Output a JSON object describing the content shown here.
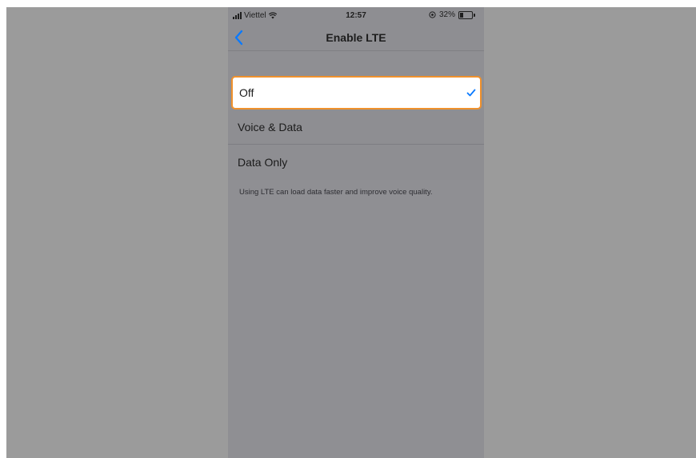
{
  "status_bar": {
    "carrier": "Viettel",
    "time": "12:57",
    "battery_percent": "32%",
    "battery_level": 0.32
  },
  "nav": {
    "title": "Enable LTE"
  },
  "options": [
    {
      "label": "Off",
      "selected": true
    },
    {
      "label": "Voice & Data",
      "selected": false
    },
    {
      "label": "Data Only",
      "selected": false
    }
  ],
  "footer_note": "Using LTE can load data faster and improve voice quality.",
  "colors": {
    "accent": "#0a7aff",
    "highlight_border": "#f0912c",
    "overlay_gray": "#9b9b9b"
  }
}
